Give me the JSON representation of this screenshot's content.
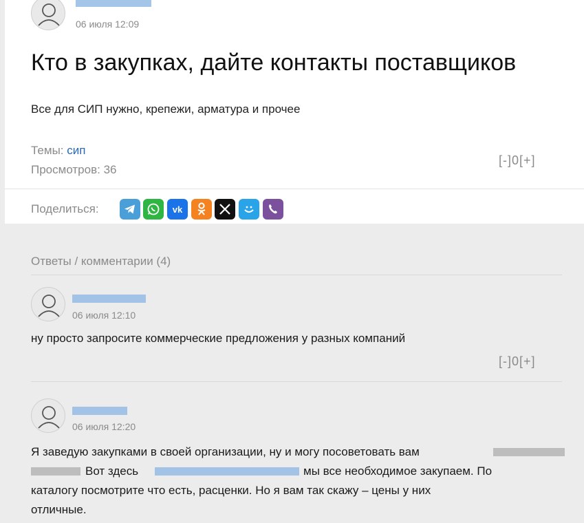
{
  "post": {
    "date": "06 июля 12:09",
    "title": "Кто в закупках, дайте контакты поставщиков",
    "body": "Все для СИП нужно, крепежи, арматура и прочее",
    "topics_label": "Темы:",
    "topic": "сип",
    "views_label": "Просмотров:",
    "views": "36",
    "vote": {
      "minus": "[-]",
      "count": "0",
      "plus": "[+]"
    }
  },
  "share": {
    "label": "Поделиться:",
    "icons": [
      "telegram-icon",
      "whatsapp-icon",
      "vk-icon",
      "odnoklassniki-icon",
      "x-icon",
      "moimir-icon",
      "viber-icon"
    ],
    "colors": {
      "telegram": "#4a9fd9",
      "whatsapp": "#2fb543",
      "vk": "#1a73e8",
      "ok": "#f58220",
      "x": "#111111",
      "moimir": "#2aa4e8",
      "viber": "#7b519d"
    }
  },
  "comments": {
    "header": "Ответы / комментарии (4)",
    "items": [
      {
        "date": "06 июля 12:10",
        "text": "ну просто запросите коммерческие предложения у разных компаний",
        "vote": {
          "minus": "[-]",
          "count": "0",
          "plus": "[+]"
        }
      },
      {
        "date": "06 июля 12:20",
        "line1": "Я заведую закупками в своей организации, ну и могу посоветовать вам",
        "line2a": "Вот здесь",
        "line2b": "мы все необходимое закупаем. По",
        "line3": "каталогу посмотрите что есть, расценки. Но я вам так скажу – цены у них",
        "line4": "отличные."
      }
    ]
  }
}
